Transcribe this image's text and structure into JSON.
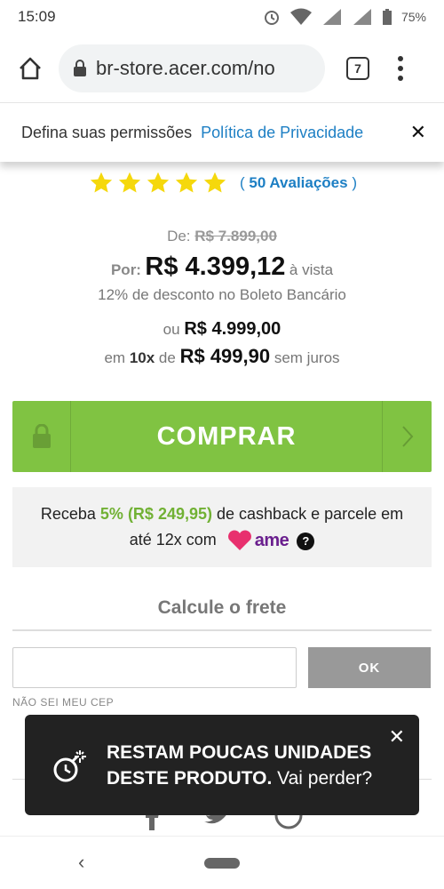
{
  "status_bar": {
    "time": "15:09",
    "battery": "75%"
  },
  "browser": {
    "url": "br-store.acer.com/no",
    "tab_count": "7"
  },
  "cookie_banner": {
    "text": "Defina suas permissões",
    "link": "Política de Privacidade",
    "close": "✕"
  },
  "rating": {
    "stars": 5,
    "reviews_open": "(",
    "reviews_label": "50 Avaliações",
    "reviews_close": ")"
  },
  "pricing": {
    "from_label": "De:",
    "old_price": "R$ 7.899,00",
    "by_label": "Por:",
    "price": "R$ 4.399,12",
    "cash_note": "à vista",
    "discount_note": "12% de desconto no Boleto Bancário",
    "or_label": "ou",
    "alt_price": "R$ 4.999,00",
    "inst_prefix": "em",
    "inst_count": "10x",
    "inst_de": "de",
    "inst_value": "R$ 499,90",
    "inst_suffix": "sem juros"
  },
  "buy_button": {
    "label": "COMPRAR"
  },
  "cashback": {
    "prefix": "Receba",
    "highlight": "5% (R$ 249,95)",
    "middle": "de cashback e parcele em",
    "line2": "até 12x com",
    "brand": "ame",
    "help": "?"
  },
  "shipping": {
    "title": "Calcule o frete",
    "input_value": "",
    "ok_label": "OK",
    "help_link": "NÃO SEI MEU CEP"
  },
  "toast": {
    "line1": "RESTAM POUCAS UNIDADES",
    "line2_bold": "DESTE PRODUTO.",
    "line2_rest": "Vai perder?",
    "close": "✕"
  },
  "nav": {
    "back": "‹"
  },
  "colors": {
    "accent_green": "#80c342",
    "link_blue": "#1d7fc4",
    "star_yellow": "#f5d80c"
  }
}
